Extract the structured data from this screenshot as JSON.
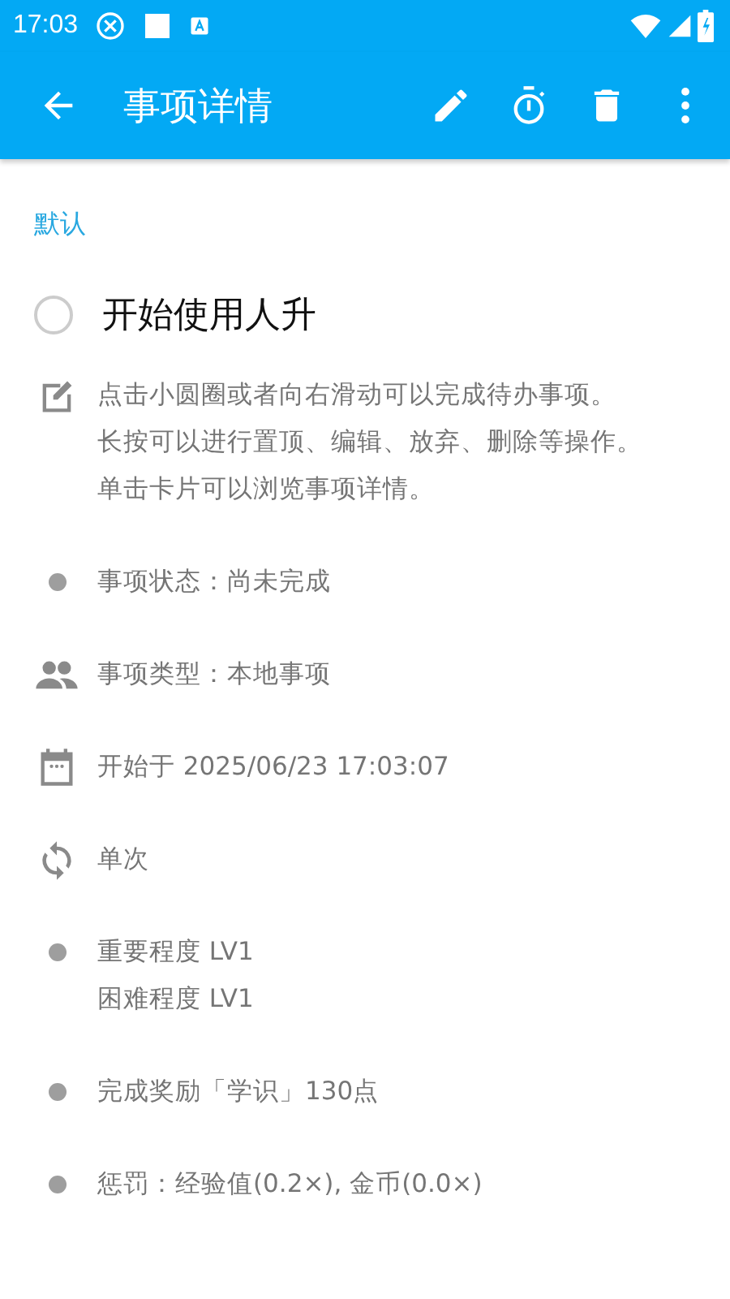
{
  "status_bar": {
    "time": "17:03"
  },
  "toolbar": {
    "title": "事项详情"
  },
  "category": "默认",
  "task": {
    "title": "开始使用人升",
    "checked": false
  },
  "details": [
    {
      "kind": "note",
      "lines": [
        "点击小圆圈或者向右滑动可以完成待办事项。",
        "长按可以进行置顶、编辑、放弃、删除等操作。",
        "单击卡片可以浏览事项详情。"
      ]
    },
    {
      "kind": "dot",
      "lines": [
        "事项状态：尚未完成"
      ]
    },
    {
      "kind": "people",
      "lines": [
        "事项类型：本地事项"
      ]
    },
    {
      "kind": "calendar",
      "lines": [
        "开始于 2025/06/23 17:03:07"
      ]
    },
    {
      "kind": "repeat",
      "lines": [
        "单次"
      ]
    },
    {
      "kind": "dot",
      "lines": [
        "重要程度 LV1",
        "困难程度 LV1"
      ]
    },
    {
      "kind": "dot",
      "lines": [
        "完成奖励「学识」130点"
      ]
    },
    {
      "kind": "dot",
      "lines": [
        "惩罚：经验值(0.2×), 金币(0.0×)"
      ]
    }
  ]
}
